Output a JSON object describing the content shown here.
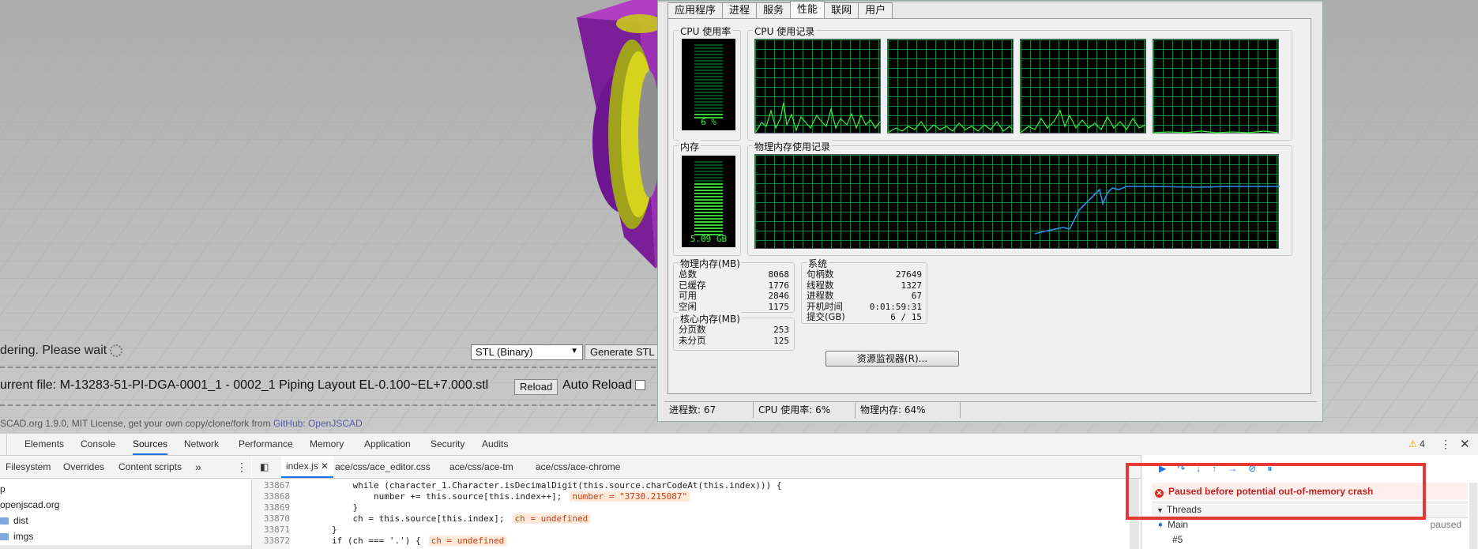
{
  "viewer": {
    "status": "dering. Please wait",
    "format_value": "STL (Binary)",
    "generate_label": "Generate STL",
    "current_file": "urrent file: M-13283-51-PI-DGA-0001_1 - 0002_1 Piping Layout EL-0.100~EL+7.000.stl",
    "reload_label": "Reload",
    "auto_reload_label": "Auto Reload",
    "footer_text": "SCAD.org 1.9.0, MIT License, get your own copy/clone/fork from ",
    "footer_link": "GitHub: OpenJSCAD"
  },
  "task_manager": {
    "tabs": [
      "应用程序",
      "进程",
      "服务",
      "性能",
      "联网",
      "用户"
    ],
    "active_tab": "性能",
    "cpu_usage_title": "CPU 使用率",
    "cpu_usage_value": "6 %",
    "cpu_history_title": "CPU 使用记录",
    "memory_title": "内存",
    "memory_value": "5.09 GB",
    "memory_history_title": "物理内存使用记录",
    "physical_memory": {
      "title": "物理内存(MB)",
      "rows": [
        {
          "label": "总数",
          "value": "8068"
        },
        {
          "label": "已缓存",
          "value": "1776"
        },
        {
          "label": "可用",
          "value": "2846"
        },
        {
          "label": "空闲",
          "value": "1175"
        }
      ]
    },
    "kernel_memory": {
      "title": "核心内存(MB)",
      "rows": [
        {
          "label": "分页数",
          "value": "253"
        },
        {
          "label": "未分页",
          "value": "125"
        }
      ]
    },
    "system": {
      "title": "系统",
      "rows": [
        {
          "label": "句柄数",
          "value": "27649"
        },
        {
          "label": "线程数",
          "value": "1327"
        },
        {
          "label": "进程数",
          "value": "67"
        },
        {
          "label": "开机时间",
          "value": "0:01:59:31"
        },
        {
          "label": "提交(GB)",
          "value": "6 / 15"
        }
      ]
    },
    "resource_monitor_label": "资源监视器(R)...",
    "status": {
      "processes": "进程数: 67",
      "cpu": "CPU 使用率: 6%",
      "memory": "物理内存: 64%"
    }
  },
  "devtools": {
    "tabs": [
      "Elements",
      "Console",
      "Sources",
      "Network",
      "Performance",
      "Memory",
      "Application",
      "Security",
      "Audits"
    ],
    "active_tab": "Sources",
    "warning_count": "4",
    "nav_tabs": [
      "Filesystem",
      "Overrides",
      "Content scripts"
    ],
    "nav_more": "»",
    "file_tabs": [
      "index.js",
      "ace/css/ace_editor.css",
      "ace/css/ace-tm",
      "ace/css/ace-chrome"
    ],
    "tree": [
      "p",
      "openjscad.org",
      "dist",
      "imgs"
    ],
    "code_lines": [
      {
        "ln": "33867",
        "code": "            while (character_1.Character.isDecimalDigit(this.source.charCodeAt(this.index))) {",
        "val": ""
      },
      {
        "ln": "33868",
        "code": "                number += this.source[this.index++];",
        "val": "number = \"3730.215087\""
      },
      {
        "ln": "33869",
        "code": "            }",
        "val": ""
      },
      {
        "ln": "33870",
        "code": "            ch = this.source[this.index];",
        "val": "ch = undefined"
      },
      {
        "ln": "33871",
        "code": "        }",
        "val": ""
      },
      {
        "ln": "33872",
        "code": "        if (ch === '.') {",
        "val": "ch = undefined"
      }
    ],
    "paused_message": "Paused before potential out-of-memory crash",
    "threads_label": "Threads",
    "threads": [
      {
        "name": "Main",
        "status": "paused"
      },
      {
        "name": "#5",
        "status": ""
      }
    ]
  }
}
